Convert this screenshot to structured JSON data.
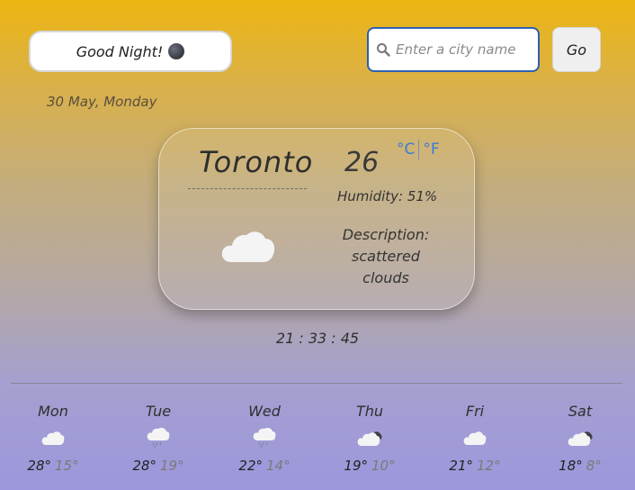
{
  "header": {
    "greeting": "Good Night!",
    "moon_icon": "new-moon-icon",
    "search": {
      "placeholder": "Enter a city name",
      "value": "",
      "icon": "search-icon"
    },
    "go_label": "Go"
  },
  "date": "30 May, Monday",
  "current": {
    "city": "Toronto",
    "temperature": "26",
    "unit_c": "°C",
    "unit_f": "°F",
    "humidity": "Humidity: 51%",
    "description_label": "Description:",
    "description_value": "scattered clouds",
    "icon": "cloud-icon"
  },
  "clock": "21 : 33 : 45",
  "forecast": [
    {
      "day": "Mon",
      "high": "28°",
      "low": "15°",
      "icon": "cloud-icon"
    },
    {
      "day": "Tue",
      "high": "28°",
      "low": "19°",
      "icon": "rain-icon"
    },
    {
      "day": "Wed",
      "high": "22°",
      "low": "14°",
      "icon": "rain-icon"
    },
    {
      "day": "Thu",
      "high": "19°",
      "low": "10°",
      "icon": "broken-clouds-icon"
    },
    {
      "day": "Fri",
      "high": "21°",
      "low": "12°",
      "icon": "cloud-icon"
    },
    {
      "day": "Sat",
      "high": "18°",
      "low": "8°",
      "icon": "broken-clouds-icon"
    }
  ],
  "colors": {
    "accent": "#3b7bd6",
    "search_border": "#2f5fb0"
  }
}
